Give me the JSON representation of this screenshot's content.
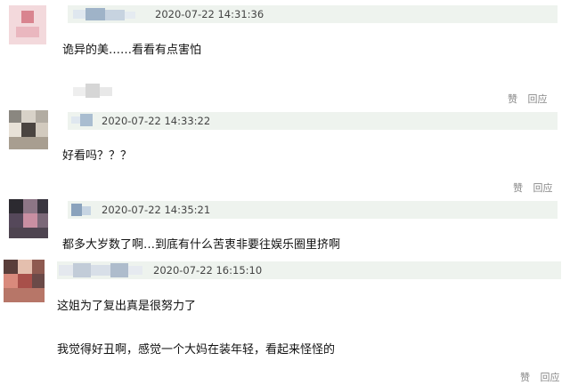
{
  "comments": [
    {
      "timestamp": "2020-07-22 14:31:36",
      "text": "诡异的美……看看有点害怕"
    },
    {
      "timestamp": "2020-07-22 14:33:22",
      "text": "好看吗？？？"
    },
    {
      "timestamp": "2020-07-22 14:35:21",
      "text": "都多大岁数了啊…到底有什么苦衷非要往娱乐圈里挤啊"
    },
    {
      "timestamp": "2020-07-22 16:15:10",
      "text": "这姐为了复出真是很努力了",
      "text2": "我觉得好丑啊，感觉一个大妈在装年轻，看起来怪怪的"
    }
  ],
  "actions": {
    "like": "赞",
    "reply": "回应"
  },
  "colors": {
    "meta_bg": "#eef3ee",
    "action_text": "#888888"
  }
}
